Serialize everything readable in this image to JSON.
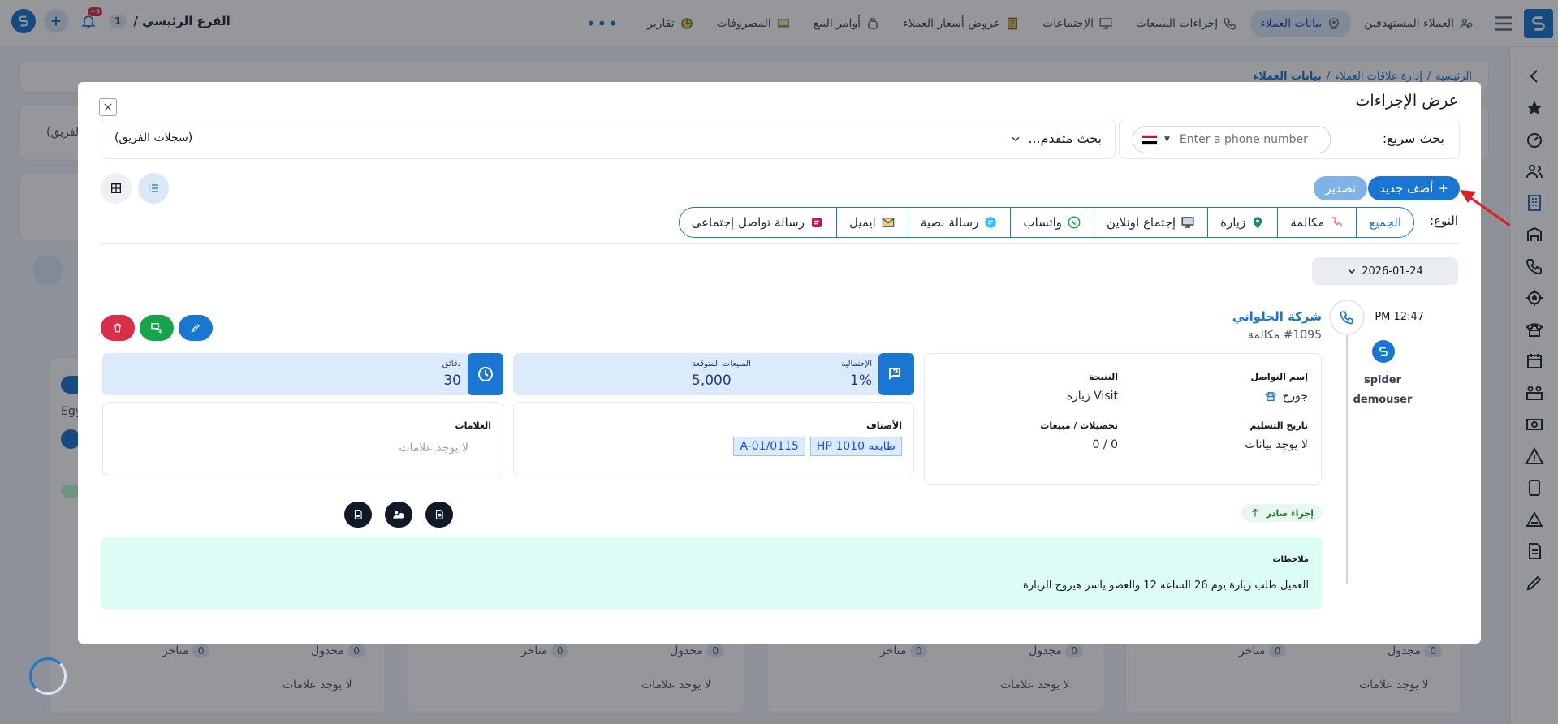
{
  "topbar": {
    "nav": [
      {
        "label": "العملاء المستهدفين",
        "icon": "users-money-icon",
        "active": false
      },
      {
        "label": "بيانات العملاء",
        "icon": "contact-data-icon",
        "active": true
      },
      {
        "label": "إجراءات المبيعات",
        "icon": "phone-icon",
        "active": false
      },
      {
        "label": "الإجتماعات",
        "icon": "presentation-icon",
        "active": false
      },
      {
        "label": "عروض أسعار العملاء",
        "icon": "document-price-icon",
        "active": false
      },
      {
        "label": "أوامر البيع",
        "icon": "money-bag-icon",
        "active": false
      },
      {
        "label": "المصروفات",
        "icon": "laptop-money-icon",
        "active": false
      },
      {
        "label": "تقارير",
        "icon": "chart-icon",
        "active": false
      }
    ],
    "more": "•••",
    "branch_name": "الفرع الرئيسي /",
    "branch_count": "1",
    "notif_count": "+9"
  },
  "background": {
    "breadcrumb": [
      "الرئيسية",
      "/",
      "إدارة علاقات العملاء",
      "/",
      "بيانات العملاء"
    ],
    "team_frag": "الفريق)",
    "card_frag": "Egy",
    "row_labels": [
      {
        "scheduled": "مجدول",
        "late": "متاخر",
        "zero": "0",
        "no_tags": "لا يوجد علامات"
      },
      {
        "scheduled": "مجدول",
        "late": "متاخر",
        "zero": "0",
        "no_tags": "لا يوجد علامات"
      },
      {
        "scheduled": "مجدول",
        "late": "متاخر",
        "zero": "0",
        "no_tags": "لا يوجد علامات"
      },
      {
        "scheduled": "مجدول",
        "late": "متاخر",
        "zero": "0",
        "no_tags": "لا يوجد علامات"
      }
    ]
  },
  "modal": {
    "title": "عرض الإجراءات",
    "quick_search_label": "بحث سريع:",
    "phone_placeholder": "Enter a phone number",
    "advanced_search_label": "بحث متقدم...",
    "team_records": "(سجلات الفريق)",
    "add_new": "أضف جديد",
    "export": "تصدير",
    "type_label": "النوع:",
    "tabs": [
      {
        "label": "الجميع",
        "icon": "",
        "active": true
      },
      {
        "label": "مكالمة",
        "icon": "phone-call-icon",
        "active": false
      },
      {
        "label": "زيارة",
        "icon": "location-pin-icon",
        "active": false
      },
      {
        "label": "إجتماع اونلاين",
        "icon": "presentation-icon",
        "active": false
      },
      {
        "label": "واتساب",
        "icon": "whatsapp-icon",
        "active": false
      },
      {
        "label": "رسالة نصية",
        "icon": "sms-icon",
        "active": false
      },
      {
        "label": "ايميل",
        "icon": "email-icon",
        "active": false
      },
      {
        "label": "رسالة تواصل إجتماعى",
        "icon": "social-message-icon",
        "active": false
      }
    ],
    "date": "2026-01-24",
    "entry": {
      "time": "PM 12:47",
      "user": [
        "spider",
        "demouser"
      ],
      "company": "شركة الحلواني",
      "number": "#1095 مكالمة",
      "contact_label": "إسم التواصل",
      "contact_value": "جورج",
      "result_label": "النتيجة",
      "result_value": "Visit زيارة",
      "delivery_label": "تاريخ التسليم",
      "delivery_value": "لا يوجد بيانات",
      "collections_label": "تحصيلات / مبيعات",
      "collections_value": "0 / 0",
      "probability_label": "الإحتمالية",
      "probability_value": "1%",
      "expected_label": "المبيعات المتوقعة",
      "expected_value": "5,000",
      "minutes_label": "دقائق",
      "minutes_value": "30",
      "items_label": "الأصناف",
      "items": [
        "طابعه HP 1010",
        "A-01/0115"
      ],
      "tags_label": "العلامات",
      "tags_value": "لا يوجد علامات",
      "outgoing": "إجراء صادر",
      "notes_label": "ملاحظات",
      "notes_text": "العميل طلب زيارة يوم 26 الساعه 12 والعضو ياسر هيروح الزيارة"
    }
  },
  "colors": {
    "primary": "#1976d2",
    "danger": "#dc2d47",
    "success": "#16a34a",
    "notes_bg": "#dcfdf5"
  }
}
